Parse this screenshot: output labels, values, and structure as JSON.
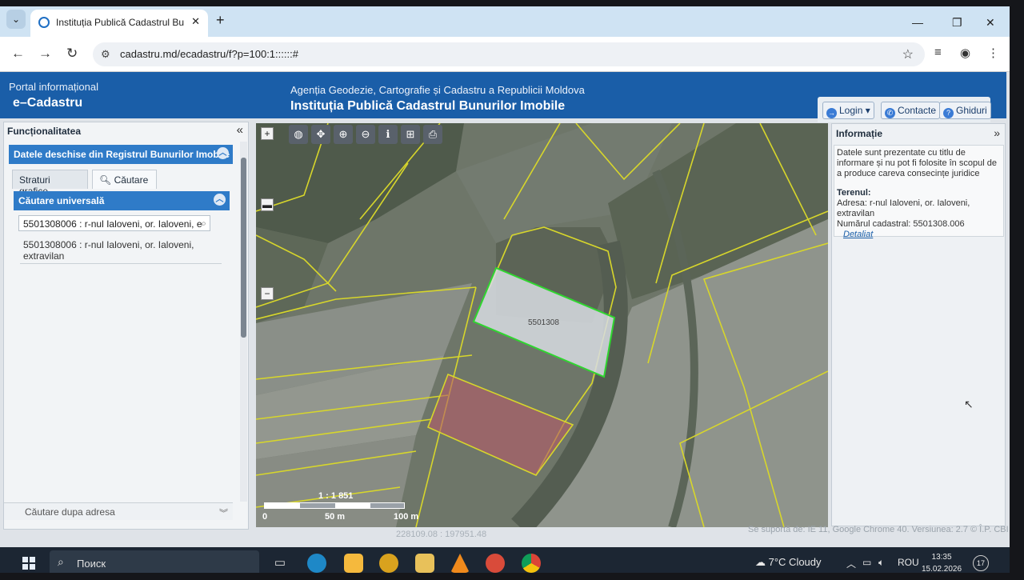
{
  "browser": {
    "tab_title": "Instituția Publică Cadastrul Bun",
    "url": "cadastru.md/ecadastru/f?p=100:1::::::#"
  },
  "header": {
    "portal_small": "Portal informațional",
    "portal_name": "e–Cadastru",
    "agency": "Agenția Geodezie, Cartografie și Cadastru a Republicii Moldova",
    "institution": "Instituția Publică Cadastrul Bunurilor Imobile",
    "login": "Login",
    "contacts": "Contacte",
    "guides": "Ghiduri"
  },
  "left_panel": {
    "title": "Funcționalitatea",
    "section": "Datele deschise din Registrul Bunurilor Imobile",
    "tab_layers": "Straturi grafice",
    "tab_search": "Căutare",
    "universal": "Căutare universală",
    "search_value": "5501308006 : r-nul Ialoveni, or. Ialoveni, e",
    "result_line1": "5501308006 : r-nul Ialoveni, or. Ialoveni,",
    "result_line2": "extravilan",
    "bottom": "Căutare dupa adresa"
  },
  "map": {
    "parcel_label": "5501308",
    "scale_ratio": "1 : 1 851",
    "scale_0": "0",
    "scale_50": "50 m",
    "scale_100": "100 m",
    "zoom_in": "+",
    "zoom_out": "−"
  },
  "right_panel": {
    "title": "Informație",
    "disclaimer": "Datele sunt prezentate cu titlu de informare și nu pot fi folosite în scopul de a produce careva consecințe juridice",
    "land_label": "Terenul:",
    "address": "Adresa: r-nul Ialoveni, or. Ialoveni, extravilan",
    "cadastral": "Numărul cadastral: 5501308.006",
    "detail_link": "Detaliat"
  },
  "footer": {
    "support": "Se suportă de: IE 11, Google Chrome 40. Versiunea: 2.7 © Î.P. CBI",
    "coords": "228109.08 : 197951.48"
  },
  "taskbar": {
    "search_placeholder": "Поиск",
    "weather": "7°C  Cloudy",
    "lang": "ROU",
    "time": "13:35",
    "date": "15.02.2026",
    "notifications": "17"
  }
}
